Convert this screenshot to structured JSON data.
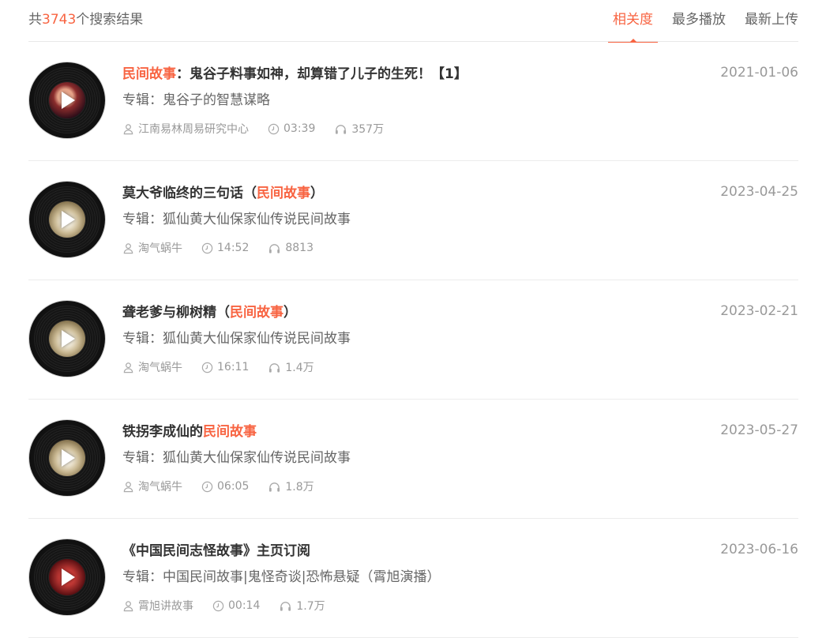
{
  "header": {
    "count_prefix": "共",
    "count_value": "3743",
    "count_suffix": "个搜索结果",
    "sort_tabs": [
      {
        "label": "相关度"
      },
      {
        "label": "最多播放"
      },
      {
        "label": "最新上传"
      }
    ]
  },
  "results": [
    {
      "title_pre": "",
      "title_hl": "民间故事",
      "title_post": "：鬼谷子料事如神，却算错了儿子的生死！【1】",
      "album": "专辑：鬼谷子的智慧谋略",
      "author": "江南易林周易研究中心",
      "duration": "03:39",
      "plays": "357万",
      "date": "2021-01-06"
    },
    {
      "title_pre": "莫大爷临终的三句话（",
      "title_hl": "民间故事",
      "title_post": "）",
      "album": "专辑：狐仙黄大仙保家仙传说民间故事",
      "author": "淘气蜗牛",
      "duration": "14:52",
      "plays": "8813",
      "date": "2023-04-25"
    },
    {
      "title_pre": "聋老爹与柳树精（",
      "title_hl": "民间故事",
      "title_post": "）",
      "album": "专辑：狐仙黄大仙保家仙传说民间故事",
      "author": "淘气蜗牛",
      "duration": "16:11",
      "plays": "1.4万",
      "date": "2023-02-21"
    },
    {
      "title_pre": "铁拐李成仙的",
      "title_hl": "民间故事",
      "title_post": "",
      "album": "专辑：狐仙黄大仙保家仙传说民间故事",
      "author": "淘气蜗牛",
      "duration": "06:05",
      "plays": "1.8万",
      "date": "2023-05-27"
    },
    {
      "title_pre": "《中国民间志怪故事》主页订阅",
      "title_hl": "",
      "title_post": "",
      "album": "专辑：中国民间故事|鬼怪奇谈|恐怖悬疑（霄旭演播）",
      "author": "霄旭讲故事",
      "duration": "00:14",
      "plays": "1.7万",
      "date": "2023-06-16"
    }
  ],
  "icons": {
    "user": "user-icon",
    "clock": "clock-icon",
    "headphones": "headphones-icon",
    "play": "play-icon"
  },
  "colors": {
    "accent": "#f86442",
    "muted": "#999999"
  }
}
